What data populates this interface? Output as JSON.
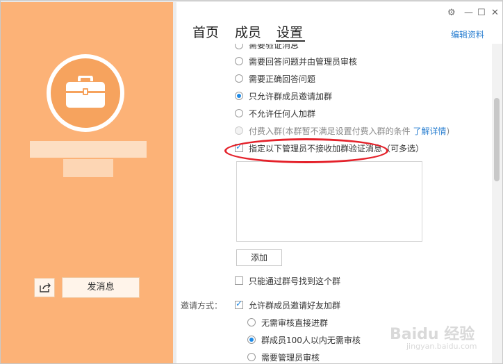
{
  "colors": {
    "sidebar": "#fcb277",
    "accent": "#1e8ae6",
    "link": "#2a7fd1",
    "highlight": "#e4212a"
  },
  "titlebar": {
    "icons": [
      "settings-icon",
      "minimize-icon",
      "maximize-icon",
      "close-icon"
    ]
  },
  "tabs": [
    {
      "label": "首页",
      "active": false
    },
    {
      "label": "成员",
      "active": false
    },
    {
      "label": "设置",
      "active": true
    }
  ],
  "edit_link": "编辑资料",
  "sidebar": {
    "send_message": "发消息",
    "share_icon": "share-icon"
  },
  "options": [
    {
      "label": "需要验证消息",
      "selected": false
    },
    {
      "label": "需要回答问题并由管理员审核",
      "selected": false
    },
    {
      "label": "需要正确回答问题",
      "selected": false
    },
    {
      "label": "只允许群成员邀请加群",
      "selected": true
    },
    {
      "label": "不允许任何人加群",
      "selected": false
    },
    {
      "label": "付费入群(本群暂不满足设置付费入群的条件",
      "link": "了解详情",
      "suffix": ")",
      "selected": false,
      "disabled": true
    }
  ],
  "admin_check": {
    "label": "指定以下管理员不接收加群验证消息（可多选）",
    "checked": true
  },
  "add_button": "添加",
  "only_by_number": {
    "label": "只能通过群号找到这个群",
    "checked": false
  },
  "invite": {
    "label": "邀请方式：",
    "allow_label": "允许群成员邀请好友加群",
    "allow_checked": true,
    "sub_options": [
      {
        "label": "无需审核直接进群",
        "selected": false
      },
      {
        "label": "群成员100人以内无需审核",
        "selected": true
      },
      {
        "label": "需要管理员审核",
        "selected": false
      }
    ]
  },
  "watermark": {
    "brand": "Baidu 经验",
    "url": "jingyan.baidu.com"
  }
}
